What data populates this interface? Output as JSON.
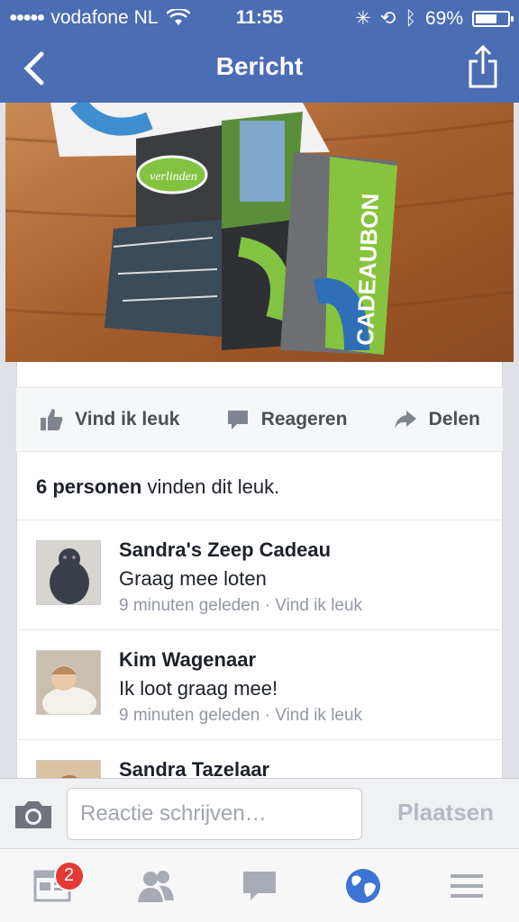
{
  "status_bar": {
    "carrier": "vodafone NL",
    "time": "11:55",
    "battery": "69%"
  },
  "navbar": {
    "title": "Bericht"
  },
  "photo": {
    "card_text": "CADEAUBON",
    "logo_text": "verlinden"
  },
  "actions": {
    "like": "Vind ik leuk",
    "comment": "Reageren",
    "share": "Delen"
  },
  "likes": {
    "count_label": "6 personen",
    "suffix": "vinden dit leuk."
  },
  "comments": [
    {
      "name": "Sandra's Zeep Cadeau",
      "text": "Graag mee loten",
      "time": "9 minuten geleden",
      "like": "Vind ik leuk"
    },
    {
      "name": "Kim Wagenaar",
      "text": "Ik loot graag mee!",
      "time": "9 minuten geleden",
      "like": "Vind ik leuk"
    },
    {
      "name": "Sandra Tazelaar",
      "text": "",
      "time": "",
      "like": ""
    }
  ],
  "composer": {
    "placeholder": "Reactie schrijven…",
    "post": "Plaatsen"
  },
  "tabbar": {
    "news_badge": "2"
  },
  "colors": {
    "brand": "#4a6db3",
    "badge": "#e53935",
    "globe": "#3b73d6"
  }
}
